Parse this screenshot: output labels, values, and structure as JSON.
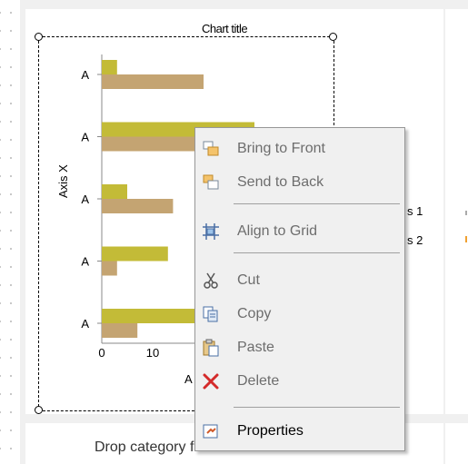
{
  "chart": {
    "title": "Chart title",
    "axis_y_title": "Axis X",
    "axis_x_title_partial": "A",
    "legend": [
      "s 1",
      "s 2"
    ],
    "colors": {
      "series1": "#c3bb37",
      "series2": "#c4a472"
    }
  },
  "chart_data": {
    "type": "bar",
    "orientation": "horizontal",
    "title": "Chart title",
    "ylabel": "Axis X",
    "categories": [
      "A",
      "A",
      "A",
      "A",
      "A"
    ],
    "series": [
      {
        "values": [
          3,
          30,
          5,
          13,
          26
        ]
      },
      {
        "values": [
          20,
          22,
          14,
          3,
          7
        ]
      }
    ],
    "x_ticks": [
      "0",
      "10"
    ],
    "xlim": [
      0,
      40
    ]
  },
  "drop_zone": {
    "text": "Drop category fields here."
  },
  "context_menu": {
    "items": [
      {
        "label": "Bring to Front",
        "icon": "bring-to-front-icon",
        "enabled": false
      },
      {
        "label": "Send to Back",
        "icon": "send-to-back-icon",
        "enabled": false
      },
      {
        "label": "Align to Grid",
        "icon": "align-to-grid-icon",
        "enabled": false
      },
      {
        "label": "Cut",
        "icon": "scissors-icon",
        "enabled": false
      },
      {
        "label": "Copy",
        "icon": "copy-icon",
        "enabled": false
      },
      {
        "label": "Paste",
        "icon": "paste-icon",
        "enabled": false
      },
      {
        "label": "Delete",
        "icon": "delete-icon",
        "enabled": false
      },
      {
        "label": "Properties",
        "icon": "properties-icon",
        "enabled": true
      }
    ]
  }
}
